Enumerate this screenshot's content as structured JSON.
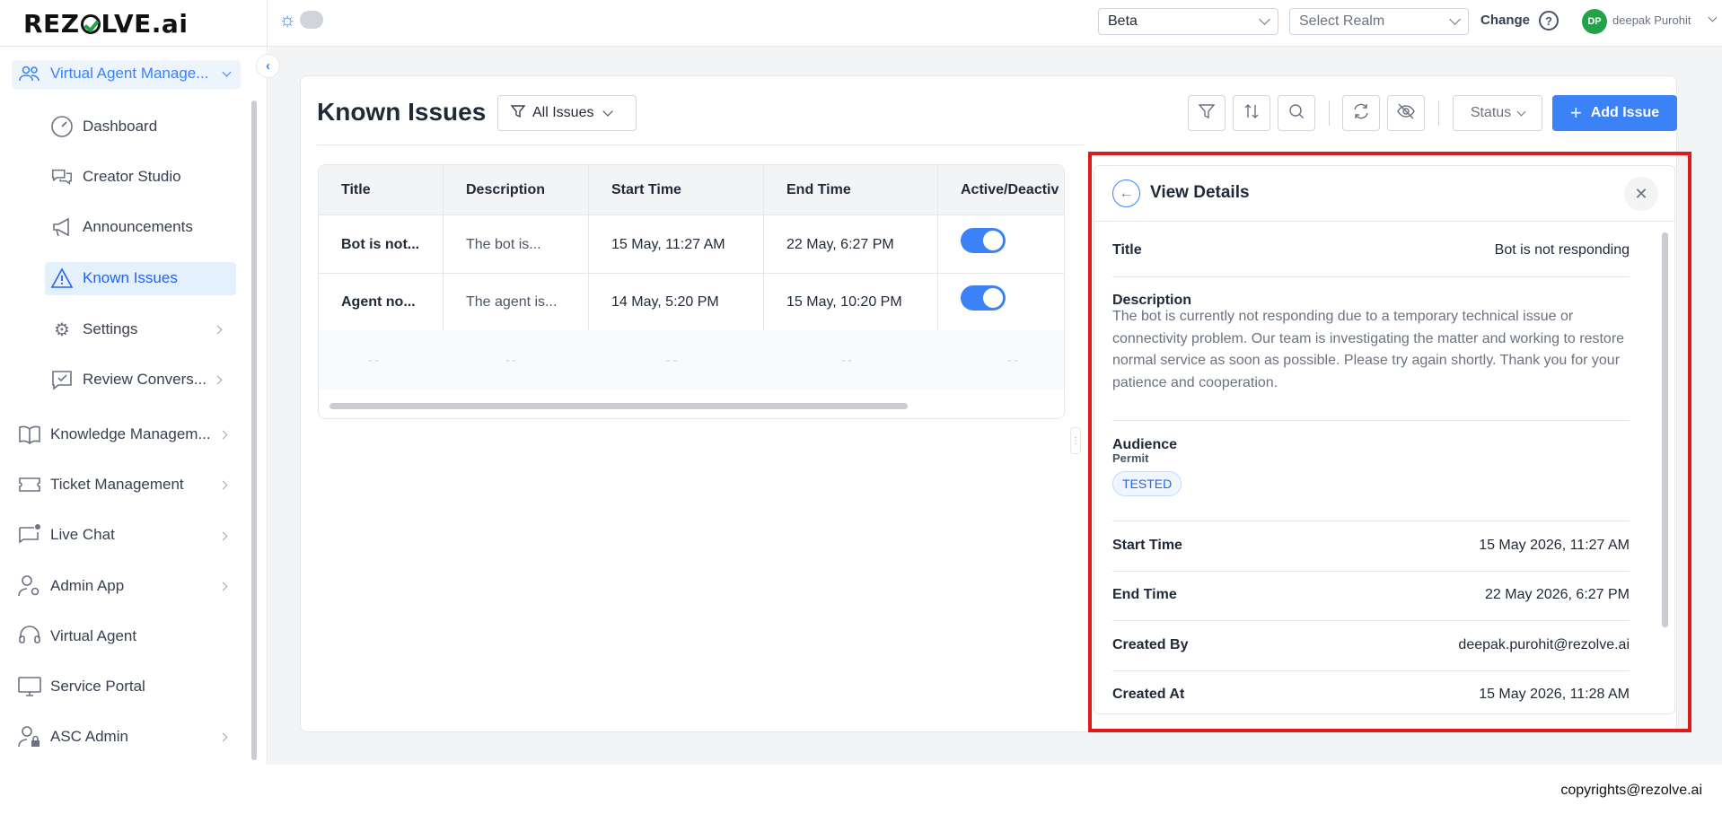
{
  "app": {
    "logo_text_left": "REZ",
    "logo_text_right": "LVE.ai"
  },
  "header": {
    "env_select": "Beta",
    "realm_placeholder": "Select Realm",
    "change_label": "Change",
    "help_symbol": "?",
    "user_initials": "DP",
    "user_name": "deepak Purohit"
  },
  "sidebar": {
    "parent": "Virtual Agent Manage...",
    "children": [
      "Dashboard",
      "Creator Studio",
      "Announcements",
      "Known Issues",
      "Settings",
      "Review Convers..."
    ],
    "sections": [
      "Knowledge Managem...",
      "Ticket Management",
      "Live Chat",
      "Admin App",
      "Virtual Agent",
      "Service Portal",
      "ASC Admin"
    ]
  },
  "page": {
    "title": "Known Issues",
    "filter_label": "All Issues",
    "status_label": "Status",
    "add_label": "Add Issue"
  },
  "table": {
    "columns": [
      "Title",
      "Description",
      "Start Time",
      "End Time",
      "Active/Deactiv"
    ],
    "rows": [
      {
        "title": "Bot is not...",
        "description": "The bot is...",
        "start": "15 May, 11:27 AM",
        "end": "22 May, 6:27 PM",
        "active": true
      },
      {
        "title": "Agent no...",
        "description": "The agent is...",
        "start": "14 May, 5:20 PM",
        "end": "15 May, 10:20 PM",
        "active": true
      }
    ],
    "empty_placeholder": "--"
  },
  "details": {
    "heading": "View Details",
    "title_label": "Title",
    "title_value": "Bot is not responding",
    "description_label": "Description",
    "description_value": "The bot is currently not responding due to a temporary technical issue or connectivity problem. Our team is investigating the matter and working to restore normal service as soon as possible. Please try again shortly. Thank you for your patience and cooperation.",
    "audience_label": "Audience",
    "permit_label": "Permit",
    "permit_chip": "TESTED",
    "start_label": "Start Time",
    "start_value": "15 May 2026, 11:27 AM",
    "end_label": "End Time",
    "end_value": "22 May 2026, 6:27 PM",
    "created_by_label": "Created By",
    "created_by_value": "deepak.purohit@rezolve.ai",
    "created_at_label": "Created At",
    "created_at_value": "15 May 2026, 11:28 AM"
  },
  "footer": {
    "copyright": "copyrights@rezolve.ai"
  },
  "colors": {
    "accent": "#3b82f6",
    "highlight": "#dc1c1c",
    "brand_check": "#22a34a"
  }
}
